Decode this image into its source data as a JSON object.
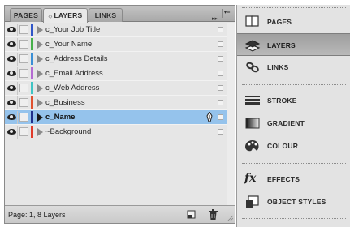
{
  "layers_panel": {
    "tabs": [
      {
        "label": "PAGES"
      },
      {
        "label": "LAYERS",
        "active": true
      },
      {
        "label": "LINKS"
      }
    ],
    "collapse_glyph": "▸▸",
    "menu_glyph": "▾≡",
    "layers": [
      {
        "name": "c_Your Job Title",
        "color": "#2f55c8",
        "selected": false
      },
      {
        "name": "c_Your Name",
        "color": "#46b04a",
        "selected": false
      },
      {
        "name": "c_Address Details",
        "color": "#3a8fd6",
        "selected": false
      },
      {
        "name": "c_Email Address",
        "color": "#b46ad2",
        "selected": false
      },
      {
        "name": "c_Web Address",
        "color": "#3fc4c4",
        "selected": false
      },
      {
        "name": "c_Business",
        "color": "#e0502e",
        "selected": false
      },
      {
        "name": "c_Name",
        "color": "#1f2e8a",
        "selected": true
      },
      {
        "name": "~Background",
        "color": "#e03a2a",
        "selected": false
      }
    ],
    "status": "Page: 1, 8 Layers"
  },
  "dock": {
    "items": [
      {
        "label": "PAGES",
        "icon": "pages-icon"
      },
      {
        "label": "LAYERS",
        "icon": "layers-icon",
        "active": true
      },
      {
        "label": "LINKS",
        "icon": "links-icon"
      },
      {
        "label": "STROKE",
        "icon": "stroke-icon"
      },
      {
        "label": "GRADIENT",
        "icon": "gradient-icon"
      },
      {
        "label": "COLOUR",
        "icon": "colour-icon"
      },
      {
        "label": "EFFECTS",
        "icon": "effects-icon",
        "glyph": "fx"
      },
      {
        "label": "OBJECT STYLES",
        "icon": "object-styles-icon"
      }
    ]
  }
}
